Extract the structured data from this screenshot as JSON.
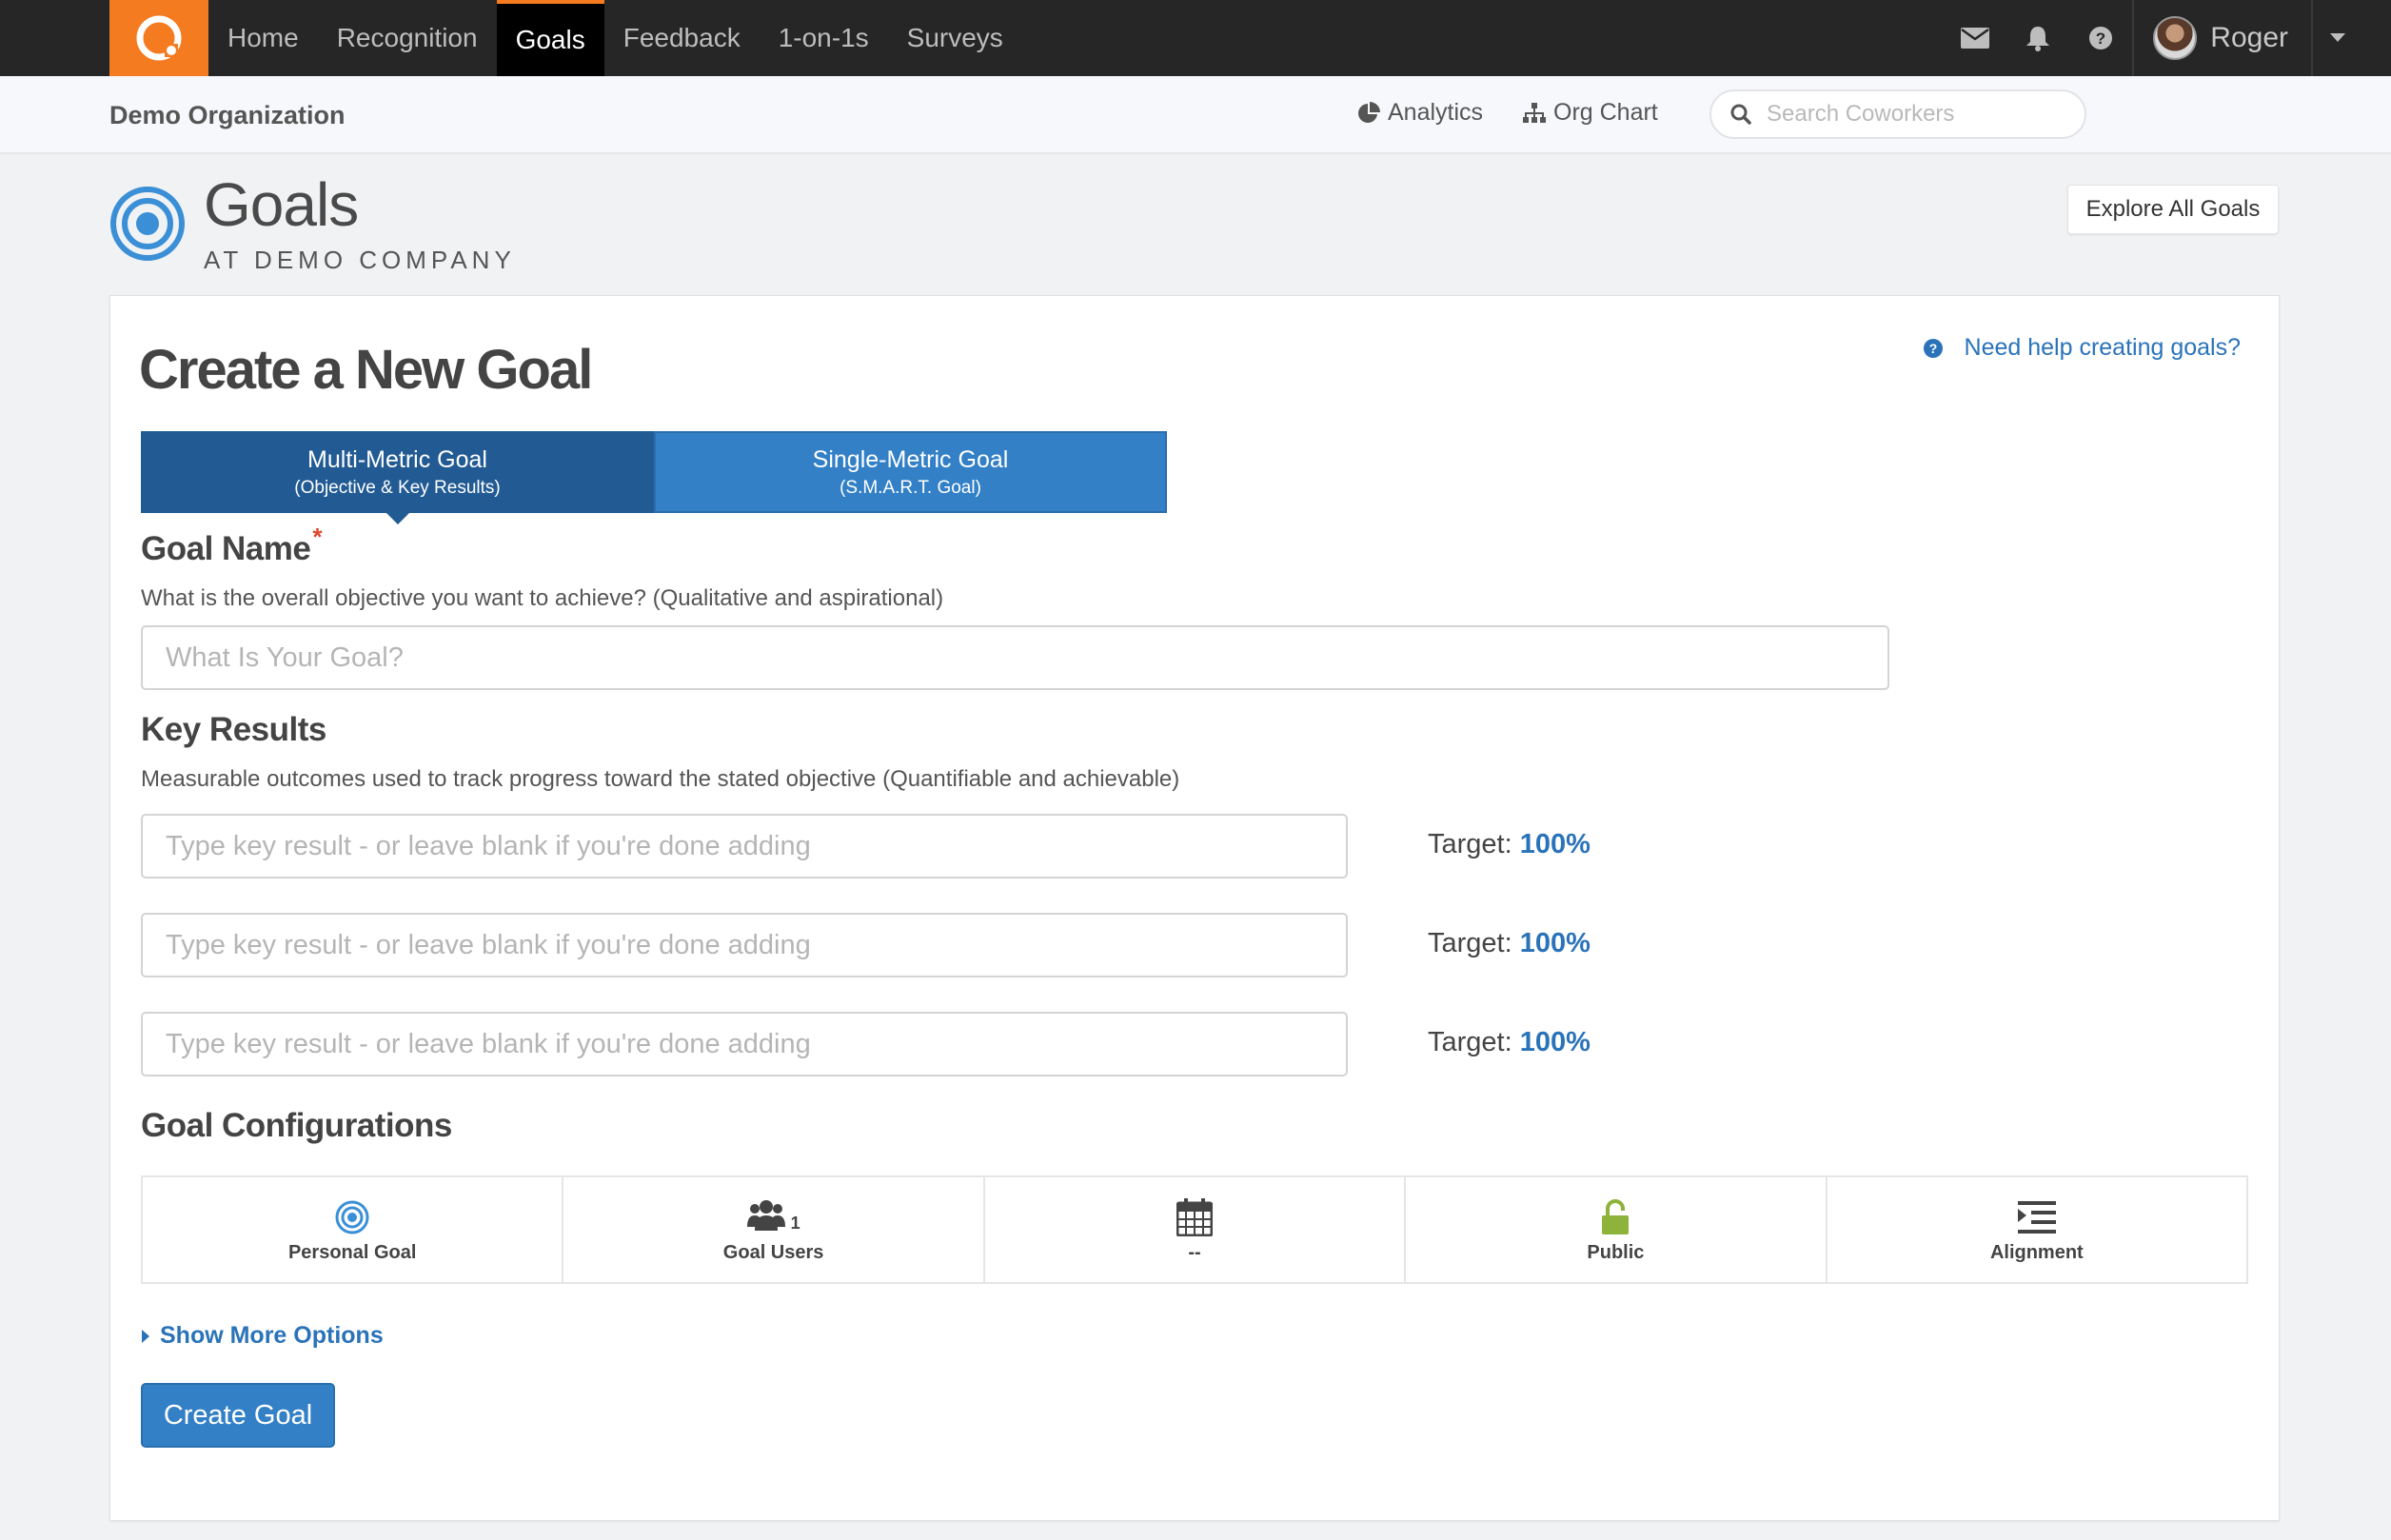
{
  "nav": {
    "items": [
      {
        "label": "Home",
        "active": false
      },
      {
        "label": "Recognition",
        "active": false
      },
      {
        "label": "Goals",
        "active": true
      },
      {
        "label": "Feedback",
        "active": false
      },
      {
        "label": "1-on-1s",
        "active": false
      },
      {
        "label": "Surveys",
        "active": false
      }
    ],
    "icons": [
      "envelope-icon",
      "bell-icon",
      "question-circle-icon"
    ],
    "user_name": "Roger"
  },
  "subheader": {
    "org_name": "Demo Organization",
    "analytics_label": "Analytics",
    "org_chart_label": "Org Chart",
    "search_placeholder": "Search Coworkers"
  },
  "page": {
    "title": "Goals",
    "subtitle": "AT DEMO COMPANY",
    "explore_label": "Explore All Goals"
  },
  "form": {
    "title": "Create a New Goal",
    "help_label": "Need help creating goals?",
    "goal_types": [
      {
        "line1": "Multi-Metric Goal",
        "line2": "(Objective & Key Results)",
        "active": true
      },
      {
        "line1": "Single-Metric Goal",
        "line2": "(S.M.A.R.T. Goal)",
        "active": false
      }
    ],
    "goal_name": {
      "label": "Goal Name",
      "required_mark": "*",
      "description": "What is the overall objective you want to achieve? (Qualitative and aspirational)",
      "placeholder": "What Is Your Goal?"
    },
    "key_results": {
      "label": "Key Results",
      "description": "Measurable outcomes used to track progress toward the stated objective (Quantifiable and achievable)",
      "placeholder": "Type key result - or leave blank if you're done adding",
      "target_label": "Target:",
      "rows": [
        {
          "target": "100%"
        },
        {
          "target": "100%"
        },
        {
          "target": "100%"
        }
      ]
    },
    "configurations": {
      "label": "Goal Configurations",
      "cells": [
        {
          "label": "Personal Goal",
          "icon": "target-icon"
        },
        {
          "label": "Goal Users",
          "icon": "users-icon",
          "count": "1"
        },
        {
          "label": "--",
          "icon": "calendar-icon"
        },
        {
          "label": "Public",
          "icon": "unlock-icon"
        },
        {
          "label": "Alignment",
          "icon": "alignment-icon"
        }
      ]
    },
    "show_more_label": "Show More Options",
    "submit_label": "Create Goal"
  },
  "colors": {
    "brand_orange": "#f47b1f",
    "primary_blue": "#3380c7",
    "active_blue": "#225b93",
    "link_blue": "#2a73b9",
    "public_green": "#8db33a"
  }
}
